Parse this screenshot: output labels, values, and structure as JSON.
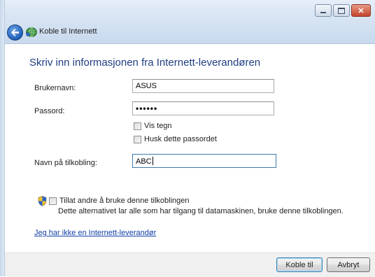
{
  "window": {
    "title": "Koble til Internett"
  },
  "form": {
    "heading": "Skriv inn informasjonen fra Internett-leverandøren",
    "username_label": "Brukernavn:",
    "username_value": "ASUS",
    "password_label": "Passord:",
    "password_value": "••••••",
    "show_chars_label": "Vis tegn",
    "remember_label": "Husk dette passordet",
    "connection_name_label": "Navn på tilkobling:",
    "connection_name_value": "ABC",
    "allow_others_label": "Tillat andre å bruke denne tilkoblingen",
    "allow_others_desc": "Dette alternativet lar alle som har tilgang til datamaskinen, bruke denne tilkoblingen.",
    "no_isp_link": "Jeg har ikke en Internett-leverandør"
  },
  "footer": {
    "connect_label": "Koble til",
    "cancel_label": "Avbryt"
  },
  "icons": [
    "back-arrow-icon",
    "network-icon",
    "uac-shield-icon",
    "minimize-icon",
    "maximize-icon",
    "close-icon"
  ]
}
